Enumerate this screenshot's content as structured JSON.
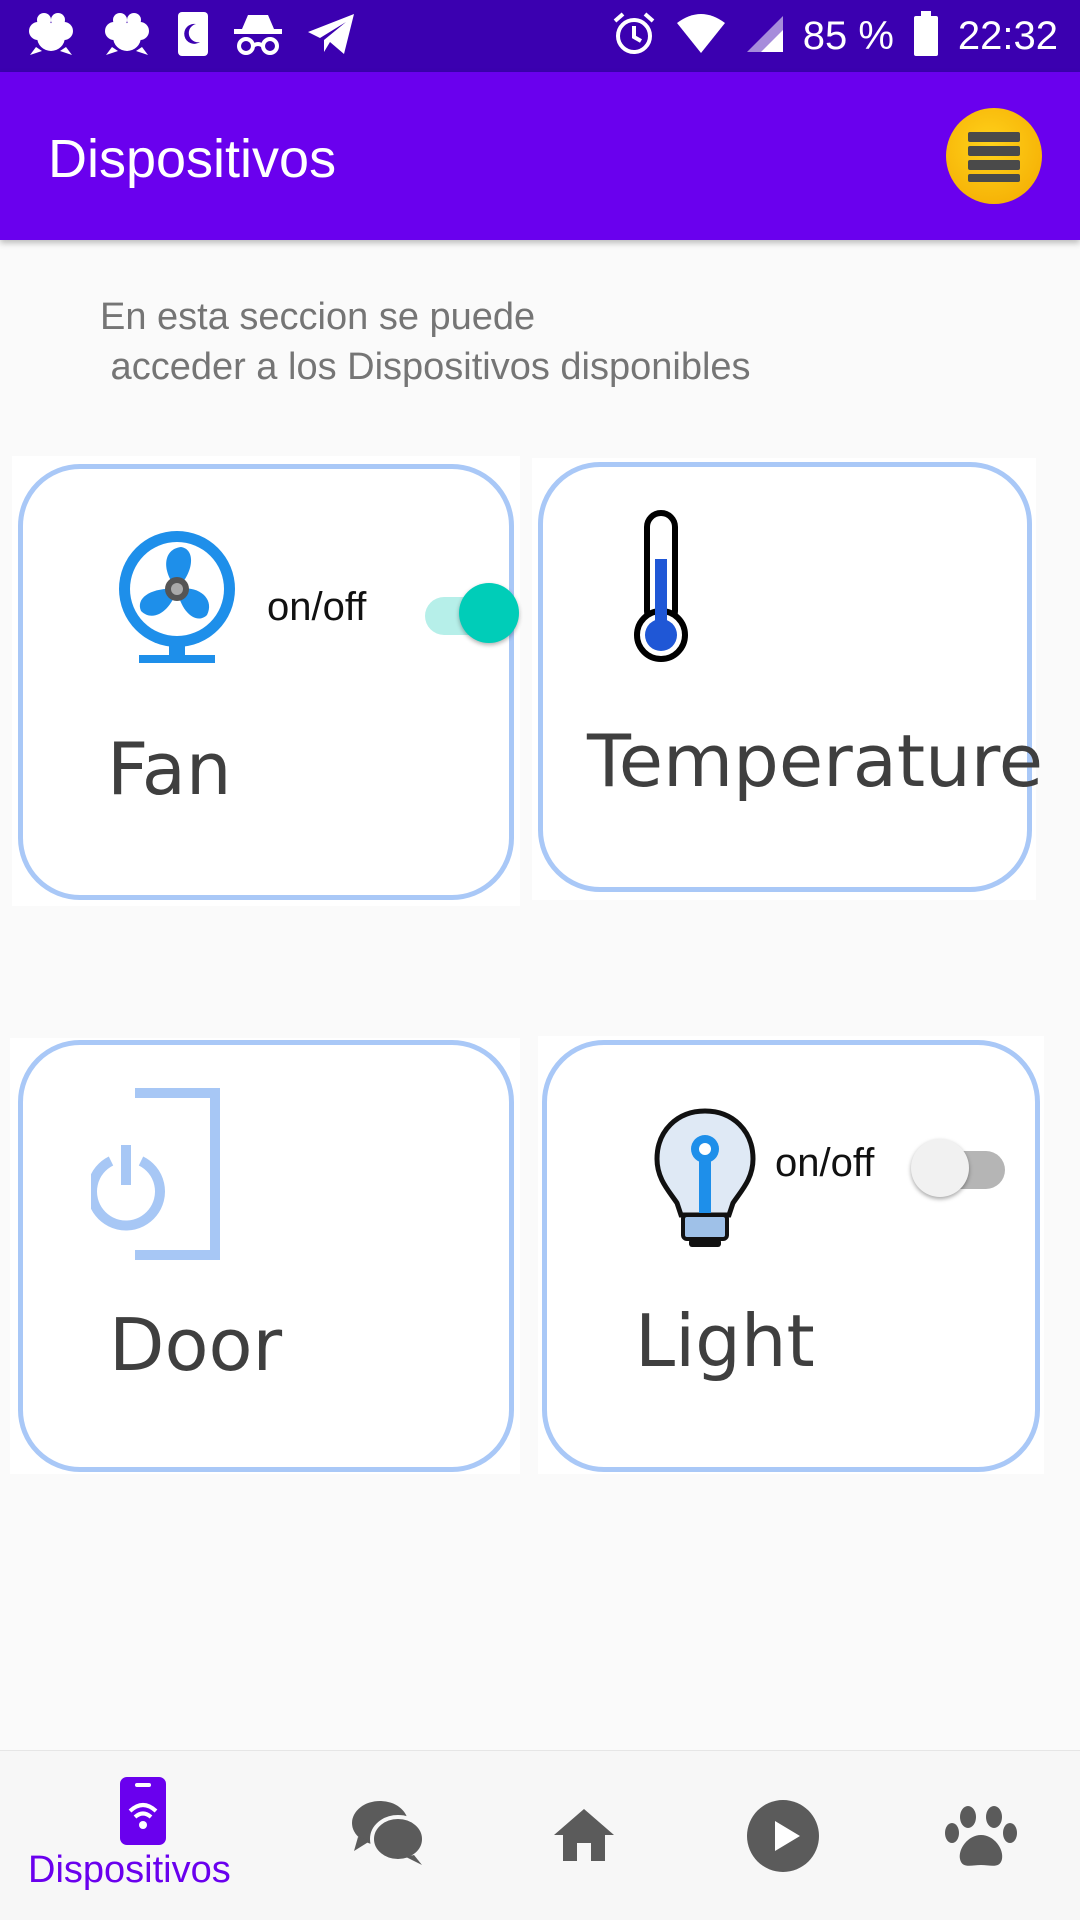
{
  "status_bar": {
    "battery_percent": "85 %",
    "time": "22:32",
    "icons": [
      "paw-cloud-icon",
      "paw-cloud-icon",
      "sim-moon-icon",
      "incognito-icon",
      "telegram-icon",
      "alarm-icon",
      "wifi-icon",
      "signal-icon",
      "battery-icon"
    ]
  },
  "app_bar": {
    "title": "Dispositivos",
    "menu_icon": "list-menu-icon",
    "menu_color": "#f7b500"
  },
  "intro": {
    "line1": "En esta seccion se puede",
    "line2": " acceder a los Dispositivos disponibles"
  },
  "devices": [
    {
      "label": "Fan",
      "icon": "fan-icon",
      "has_toggle": true,
      "toggle_label": "on/off",
      "on": true
    },
    {
      "label": "Temperature",
      "icon": "thermometer-icon",
      "has_toggle": false
    },
    {
      "label": "Door",
      "icon": "door-power-icon",
      "has_toggle": false
    },
    {
      "label": "Light",
      "icon": "lightbulb-icon",
      "has_toggle": true,
      "toggle_label": "on/off",
      "on": false
    }
  ],
  "bottom_nav": {
    "items": [
      {
        "label": "Dispositivos",
        "icon": "phone-wifi-icon",
        "active": true
      },
      {
        "label": "",
        "icon": "chat-icon",
        "active": false
      },
      {
        "label": "",
        "icon": "home-icon",
        "active": false
      },
      {
        "label": "",
        "icon": "play-icon",
        "active": false
      },
      {
        "label": "",
        "icon": "paw-icon",
        "active": false
      }
    ]
  },
  "colors": {
    "status_bar": "#3b00b0",
    "app_bar": "#6a00ee",
    "card_border": "#a9c8f7",
    "toggle_on": "#00cdb8",
    "nav_active": "#6a00ee"
  }
}
